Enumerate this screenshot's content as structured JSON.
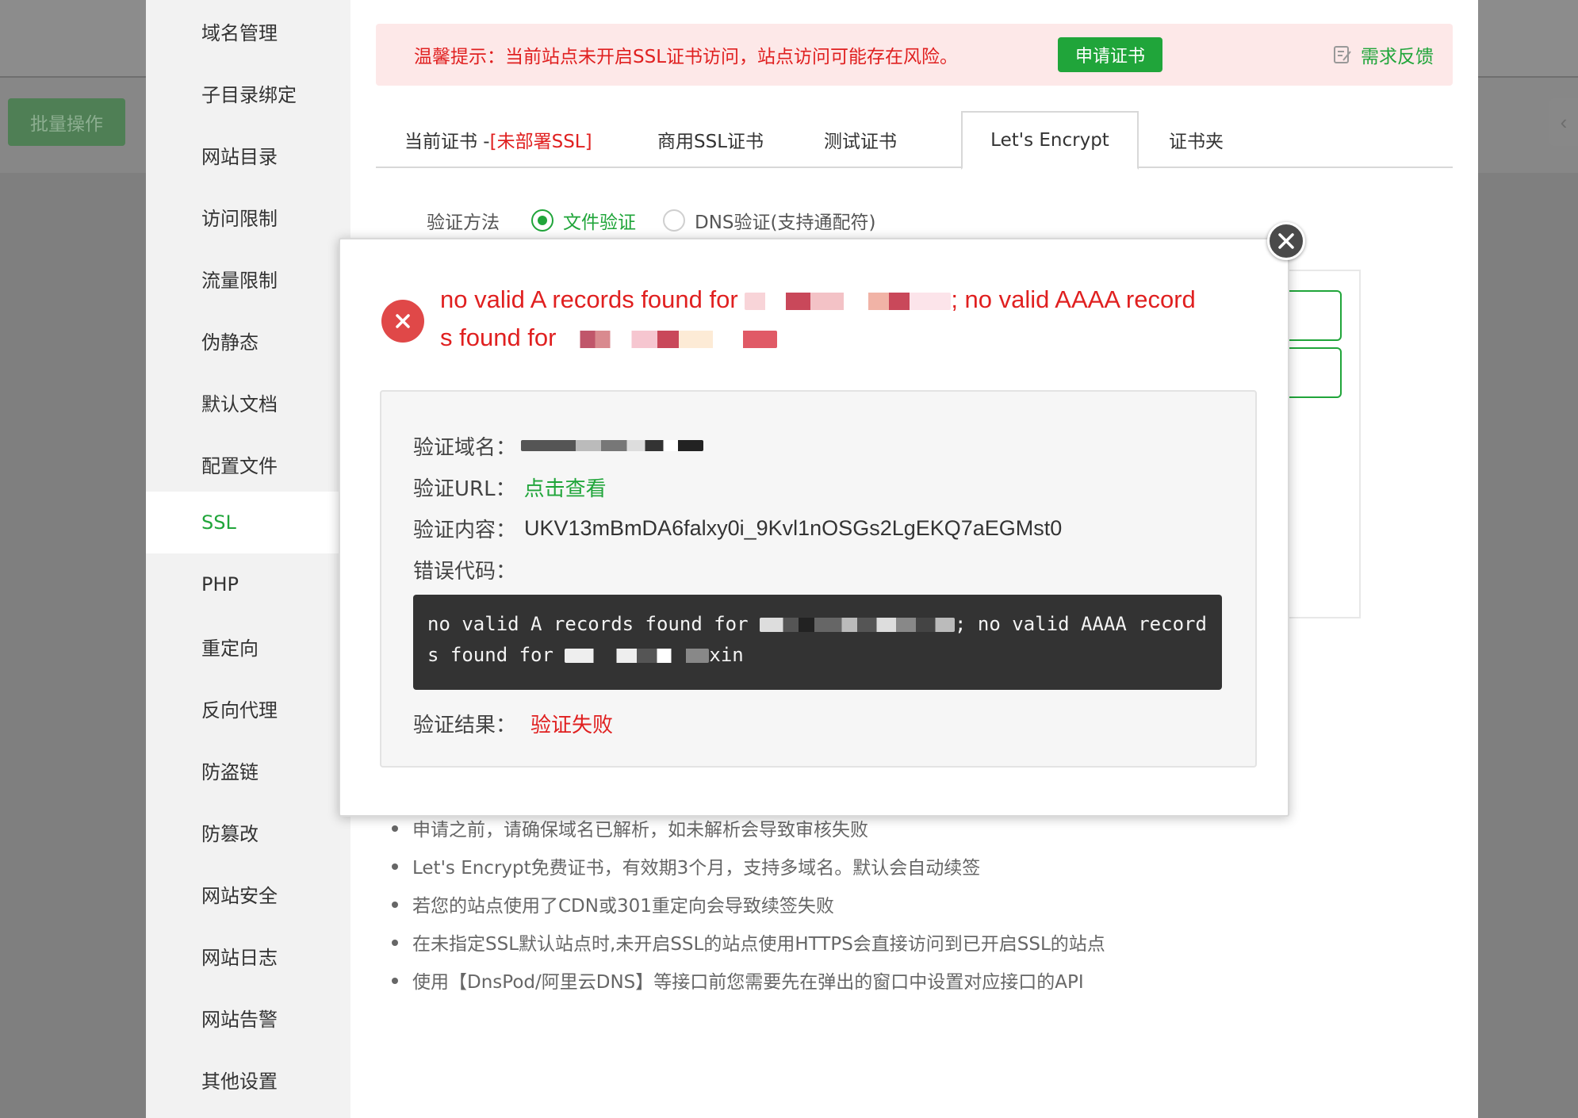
{
  "background": {
    "batch_button": "批量操作",
    "right_nub": "‹"
  },
  "sidebar": {
    "items": [
      {
        "label": "域名管理"
      },
      {
        "label": "子目录绑定"
      },
      {
        "label": "网站目录"
      },
      {
        "label": "访问限制"
      },
      {
        "label": "流量限制"
      },
      {
        "label": "伪静态"
      },
      {
        "label": "默认文档"
      },
      {
        "label": "配置文件"
      },
      {
        "label": "SSL",
        "active": true
      },
      {
        "label": "PHP"
      },
      {
        "label": "重定向"
      },
      {
        "label": "反向代理"
      },
      {
        "label": "防盗链"
      },
      {
        "label": "防篡改"
      },
      {
        "label": "网站安全"
      },
      {
        "label": "网站日志"
      },
      {
        "label": "网站告警"
      },
      {
        "label": "其他设置"
      }
    ]
  },
  "alert": {
    "text": "温馨提示：当前站点未开启SSL证书访问，站点访问可能存在风险。",
    "button": "申请证书",
    "feedback": "需求反馈",
    "feedback_icon": "edit-note-icon"
  },
  "tabs": [
    {
      "label": "当前证书 -",
      "extra": "[未部署SSL]"
    },
    {
      "label": "商用SSL证书"
    },
    {
      "label": "测试证书"
    },
    {
      "label": "Let's Encrypt",
      "active": true
    },
    {
      "label": "证书夹"
    }
  ],
  "verify": {
    "label": "验证方法",
    "options": [
      {
        "label": "文件验证",
        "selected": true
      },
      {
        "label": "DNS验证(支持通配符)",
        "selected": false
      }
    ]
  },
  "tips": [
    "申请之前，请确保域名已解析，如未解析会导致审核失败",
    "Let's Encrypt免费证书，有效期3个月，支持多域名。默认会自动续签",
    "若您的站点使用了CDN或301重定向会导致续签失败",
    "在未指定SSL默认站点时,未开启SSL的站点使用HTTPS会直接访问到已开启SSL的站点",
    "使用【DnsPod/阿里云DNS】等接口前您需要先在弹出的窗口中设置对应接口的API"
  ],
  "modal": {
    "error_part1": "no valid A records found for",
    "error_part2": "; no valid AAAA record",
    "error_part3": "s found for",
    "domain_label": "验证域名：",
    "url_label": "验证URL：",
    "url_link": "点击查看",
    "content_label": "验证内容：",
    "content_value": "UKV13mBmDA6falxy0i_9Kvl1nOSGs2LgEKQ7aEGMst0",
    "code_label": "错误代码：",
    "code_part1": "no valid A records found for",
    "code_part2": "; no valid AAAA record",
    "code_part3": "s found for",
    "code_part4": "xin",
    "result_label": "验证结果：",
    "result_value": "验证失败"
  },
  "colors": {
    "accent": "#20a53a",
    "error": "#e02020",
    "alert_bg": "#fde8e8",
    "code_bg": "#333333"
  }
}
